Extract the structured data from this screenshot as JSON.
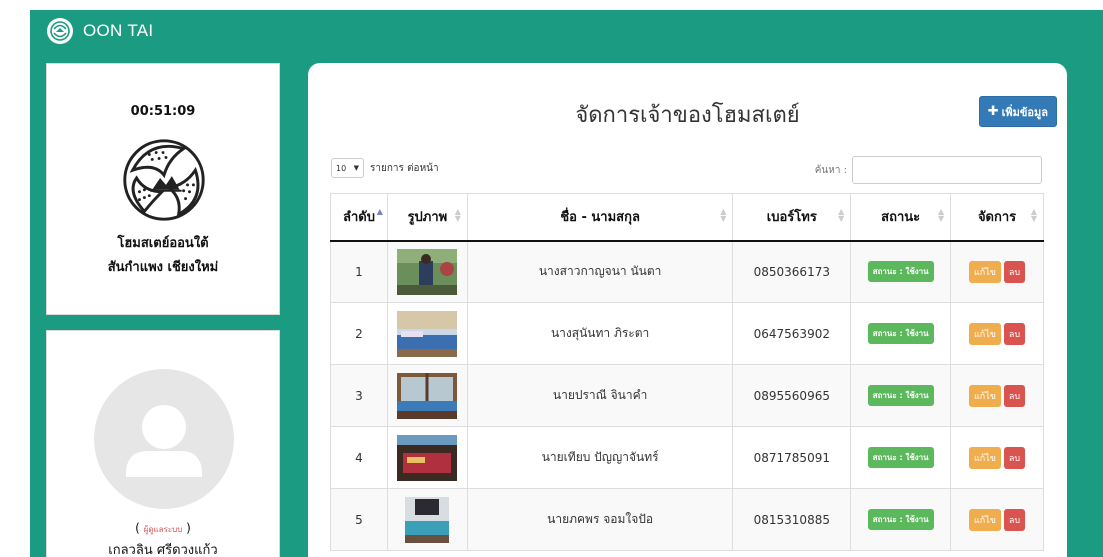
{
  "brand": {
    "title": "OON TAI"
  },
  "sidebar": {
    "clock": "00:51:09",
    "home_name_line1": "โฮมสเตย์ออนใต้",
    "home_name_line2": "สันกำแพง เชียงใหม่",
    "user_role": "ผู้ดูแลระบบ",
    "user_name": "เกลวลิน ศรีดวงแก้ว"
  },
  "main": {
    "title": "จัดการเจ้าของโฮมสเตย์",
    "add_button": "เพิ่มข้อมูล",
    "length_value": "10",
    "length_label": "รายการ ต่อหน้า",
    "search_label": "ค้นหา :"
  },
  "table": {
    "headers": [
      "ลำดับ",
      "รูปภาพ",
      "ชื่อ - นามสกุล",
      "เบอร์โทร",
      "สถานะ",
      "จัดการ"
    ],
    "status_label": "สถานะ : ใช้งาน",
    "edit_label": "แก้ไข",
    "delete_label": "ลบ",
    "rows": [
      {
        "no": "1",
        "name": "นางสาวกาญจนา นันตา",
        "phone": "0850366173"
      },
      {
        "no": "2",
        "name": "นางสุนันทา ภิระตา",
        "phone": "0647563902"
      },
      {
        "no": "3",
        "name": "นายปราณี จินาคำ",
        "phone": "0895560965"
      },
      {
        "no": "4",
        "name": "นายเทียบ ปัญญาจันทร์",
        "phone": "0871785091"
      },
      {
        "no": "5",
        "name": "นายภคพร จอมใจปัอ",
        "phone": "0815310885"
      }
    ]
  },
  "colors": {
    "page_background": "#1b9c82",
    "primary": "#337ab7",
    "success": "#5cb85c",
    "warning": "#f0ad4e",
    "danger": "#d9534f"
  }
}
